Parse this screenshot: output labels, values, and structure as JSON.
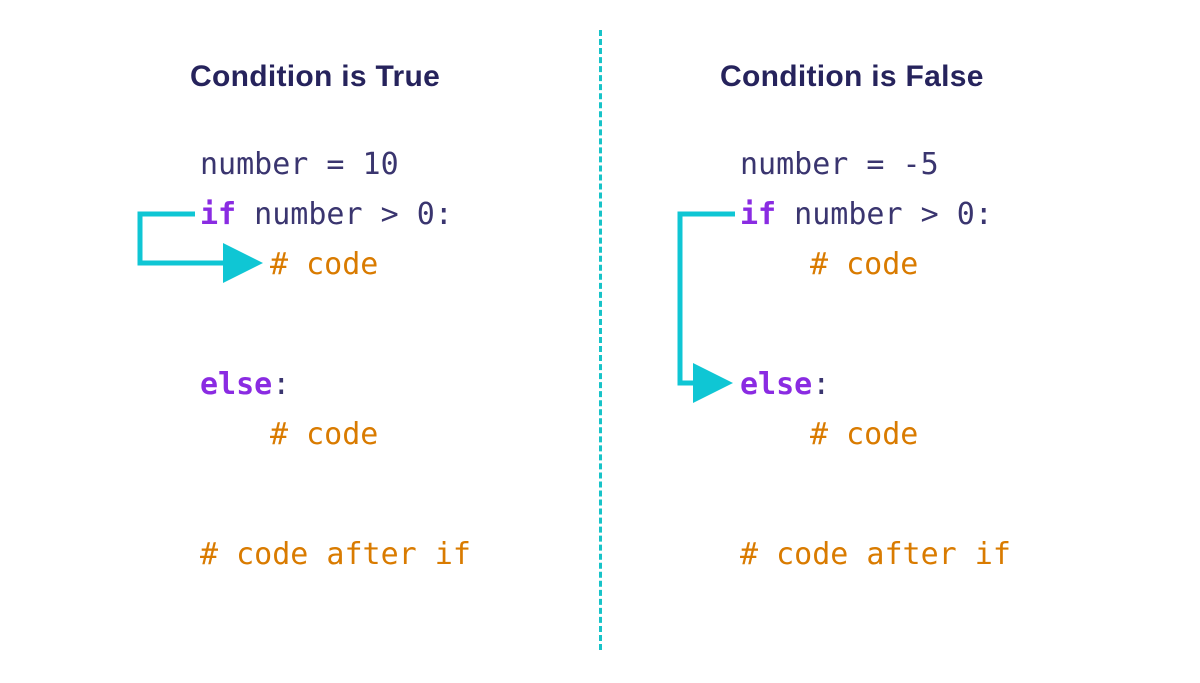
{
  "leftTitle": "Condition is True",
  "rightTitle": "Condition is False",
  "left": {
    "line1_text": "number = 10",
    "line2_kw": "if",
    "line2_rest": " number > 0:",
    "line3_comment": "# code",
    "line4_kw": "else",
    "line4_rest": ":",
    "line5_comment": "# code",
    "line6_comment": "# code after if"
  },
  "right": {
    "line1_text": "number = -5",
    "line2_kw": "if",
    "line2_rest": " number > 0:",
    "line3_comment": "# code",
    "line4_kw": "else",
    "line4_rest": ":",
    "line5_comment": "# code",
    "line6_comment": "# code after if"
  },
  "colors": {
    "heading": "#26235c",
    "code": "#3a356f",
    "keyword": "#8a2be2",
    "comment": "#d97b00",
    "arrow": "#0fc6d4",
    "arrowStroke": "#0b9ba7"
  }
}
